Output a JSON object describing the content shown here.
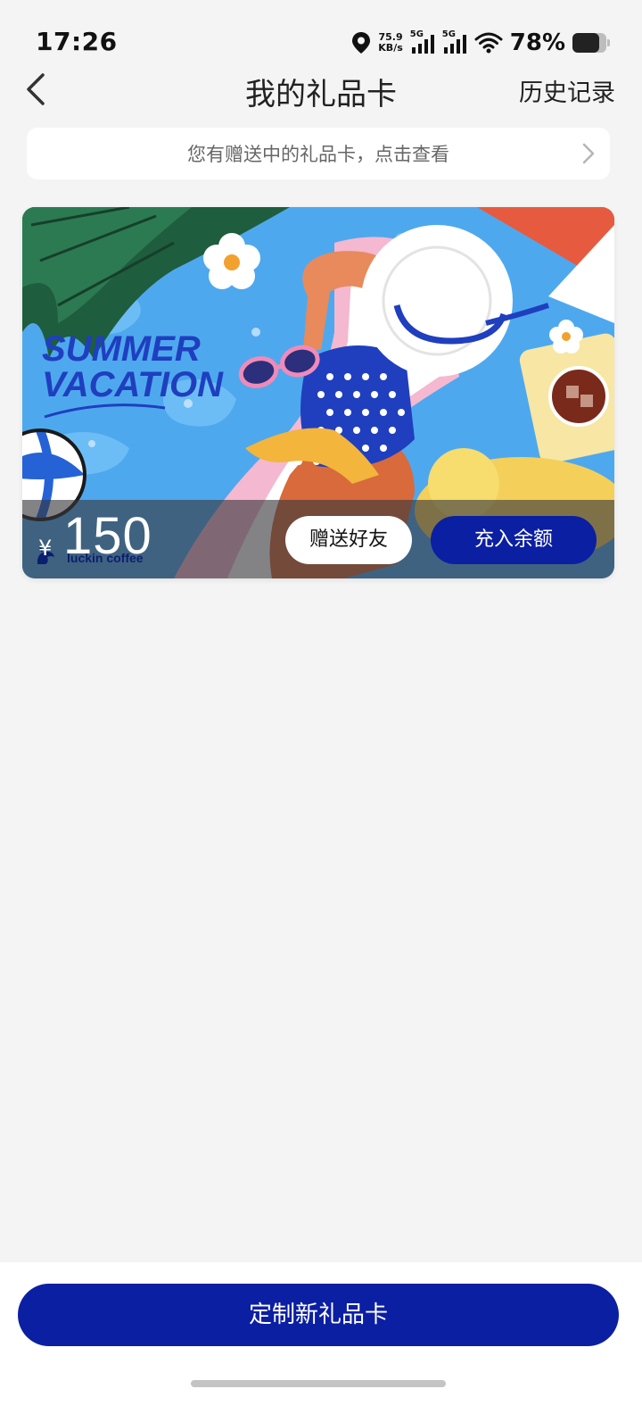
{
  "status_bar": {
    "time": "17:26",
    "net_speed_value": "75.9",
    "net_speed_unit": "KB/s",
    "signal_1_label": "5G",
    "signal_2_label": "5G",
    "battery_percent": "78%",
    "battery_level": 0.78
  },
  "nav": {
    "title": "我的礼品卡",
    "history_label": "历史记录"
  },
  "notice": {
    "text": "您有赠送中的礼品卡，点击查看"
  },
  "gift_card": {
    "art_title_line1": "SUMMER",
    "art_title_line2": "VACATION",
    "currency_symbol": "¥",
    "amount": "150",
    "brand": "luckin coffee",
    "gift_button_label": "赠送好友",
    "topup_button_label": "充入余额"
  },
  "bottom": {
    "customize_button_label": "定制新礼品卡"
  },
  "colors": {
    "primary_blue": "#0b1fa3",
    "background": "#f4f4f4"
  }
}
